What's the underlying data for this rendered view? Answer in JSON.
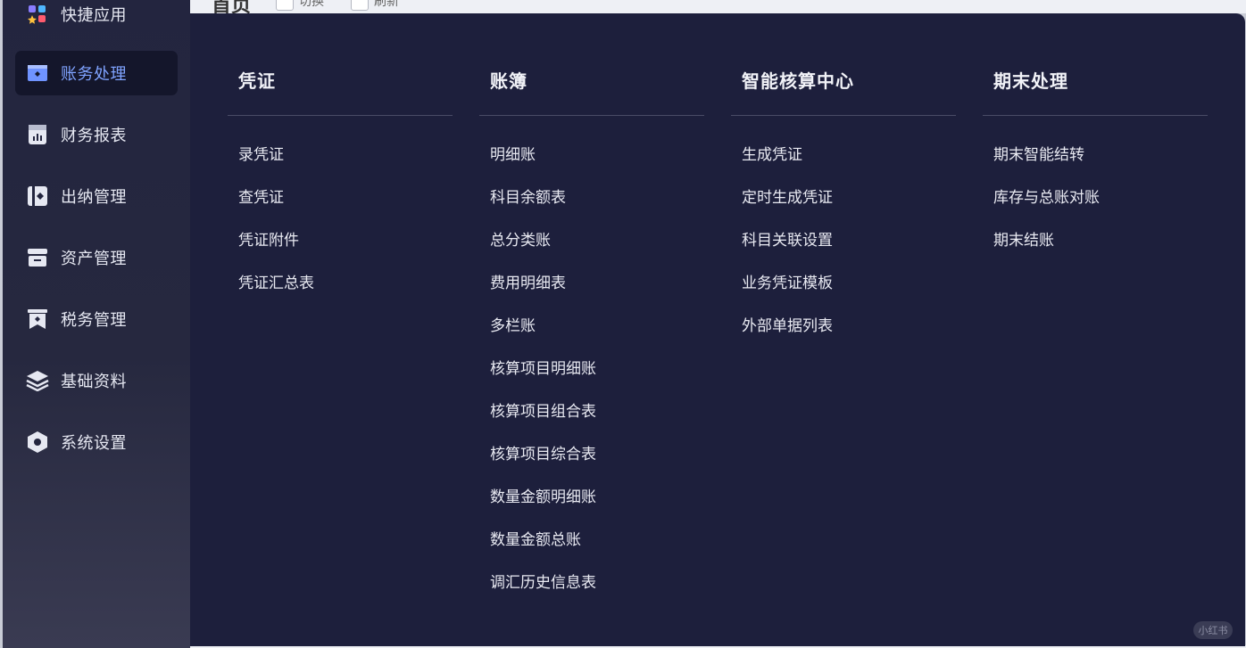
{
  "sidebar": {
    "items": [
      {
        "label": "快捷应用",
        "icon": "apps-icon"
      },
      {
        "label": "账务处理",
        "icon": "ledger-icon",
        "active": true
      },
      {
        "label": "财务报表",
        "icon": "report-icon"
      },
      {
        "label": "出纳管理",
        "icon": "cashier-icon"
      },
      {
        "label": "资产管理",
        "icon": "asset-icon"
      },
      {
        "label": "税务管理",
        "icon": "tax-icon"
      },
      {
        "label": "基础资料",
        "icon": "layers-icon"
      },
      {
        "label": "系统设置",
        "icon": "settings-icon"
      }
    ]
  },
  "topbar": {
    "page_title": "首页",
    "check1": "切换",
    "check2": "刷新"
  },
  "menu": {
    "columns": [
      {
        "title": "凭证",
        "items": [
          "录凭证",
          "查凭证",
          "凭证附件",
          "凭证汇总表"
        ]
      },
      {
        "title": "账簿",
        "items": [
          "明细账",
          "科目余额表",
          "总分类账",
          "费用明细表",
          "多栏账",
          "核算项目明细账",
          "核算项目组合表",
          "核算项目综合表",
          "数量金额明细账",
          "数量金额总账",
          "调汇历史信息表"
        ]
      },
      {
        "title": "智能核算中心",
        "items": [
          "生成凭证",
          "定时生成凭证",
          "科目关联设置",
          "业务凭证模板",
          "外部单据列表"
        ]
      },
      {
        "title": "期末处理",
        "items": [
          "期末智能结转",
          "库存与总账对账",
          "期末结账"
        ]
      }
    ]
  },
  "watermark": "小红书",
  "colors": {
    "sidebar_bg": "#23253f",
    "popover_bg": "#1d1f3c",
    "active_text": "#7fa3ff",
    "active_bg": "#14162b"
  }
}
